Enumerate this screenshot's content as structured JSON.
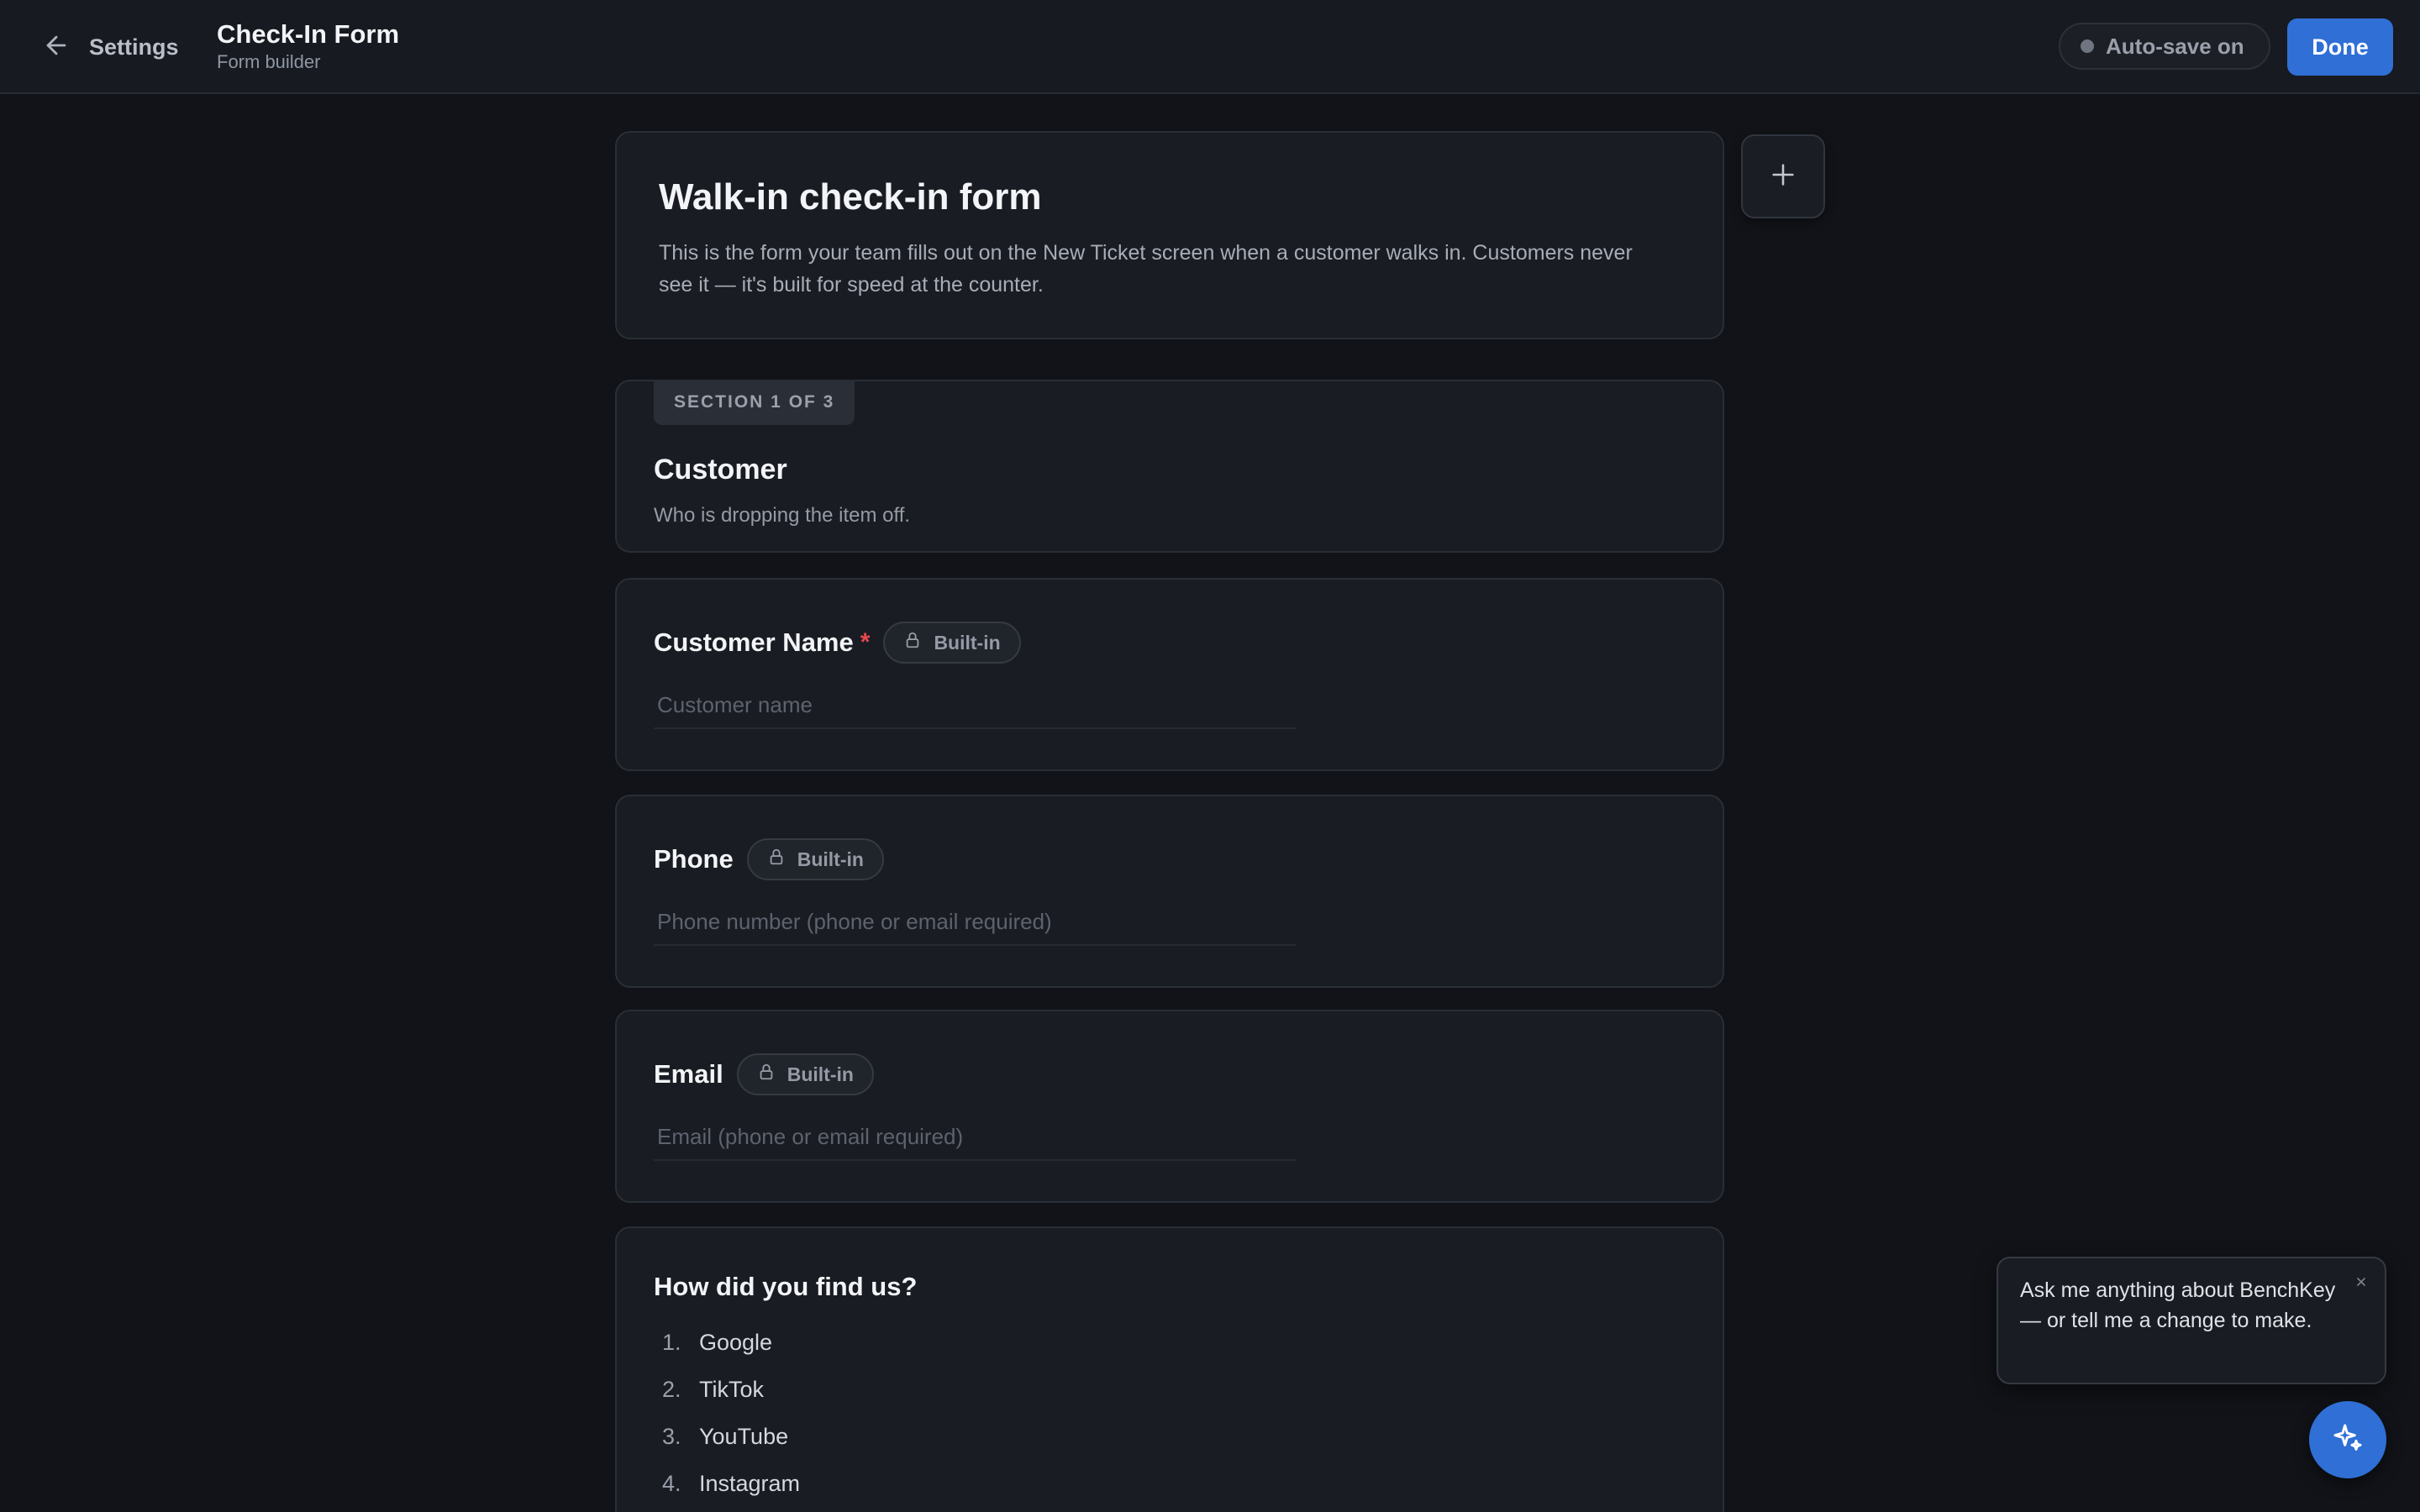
{
  "header": {
    "back_label": "Settings",
    "title": "Check-In Form",
    "subtitle": "Form builder",
    "autosave_label": "Auto-save on",
    "done_label": "Done"
  },
  "intro": {
    "title": "Walk-in check-in form",
    "description": "This is the form your team fills out on the New Ticket screen when a customer walks in. Customers never see it — it's built for speed at the counter."
  },
  "section": {
    "badge": "SECTION 1 OF 3",
    "title": "Customer",
    "description": "Who is dropping the item off."
  },
  "fields": [
    {
      "label": "Customer Name",
      "required": "*",
      "badge": "Built-in",
      "placeholder": "Customer name"
    },
    {
      "label": "Phone",
      "badge": "Built-in",
      "placeholder": "Phone number (phone or email required)"
    },
    {
      "label": "Email",
      "badge": "Built-in",
      "placeholder": "Email (phone or email required)"
    }
  ],
  "question": {
    "title": "How did you find us?",
    "options": [
      {
        "num": "1.",
        "label": "Google"
      },
      {
        "num": "2.",
        "label": "TikTok"
      },
      {
        "num": "3.",
        "label": "YouTube"
      },
      {
        "num": "4.",
        "label": "Instagram"
      }
    ]
  },
  "assistant": {
    "message": "Ask me anything about BenchKey — or tell me a change to make."
  },
  "icons": {
    "back": "arrow-left-icon",
    "plus": "plus-icon",
    "lock": "lock-icon",
    "close": "close-icon",
    "assistant": "sparkle-icon"
  },
  "colors": {
    "accent": "#2f6fd6",
    "background": "#111318",
    "card": "#191c22",
    "required": "#e5484d"
  }
}
